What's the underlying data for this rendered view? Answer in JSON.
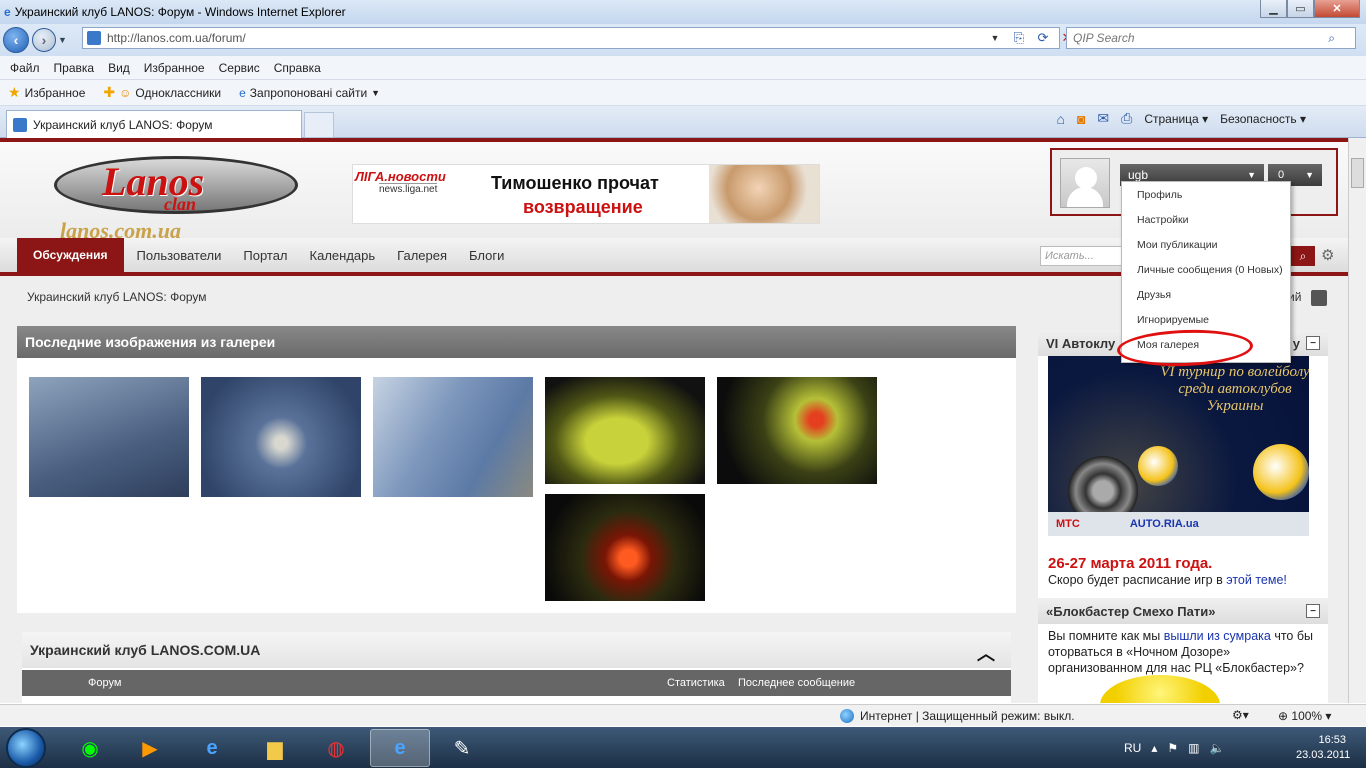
{
  "window": {
    "title": "Украинский клуб LANOS: Форум - Windows Internet Explorer"
  },
  "address": {
    "url": "http://lanos.com.ua/forum/",
    "search_placeholder": "QIP Search"
  },
  "menu": [
    "Файл",
    "Правка",
    "Вид",
    "Избранное",
    "Сервис",
    "Справка"
  ],
  "favorites": {
    "label": "Избранное",
    "items": [
      "Одноклассники",
      "Запропоновані сайти"
    ]
  },
  "tab": {
    "title": "Украинский клуб LANOS: Форум"
  },
  "command_bar": {
    "page": "Страница",
    "security": "Безопасность"
  },
  "logo": {
    "line1": "Lanos",
    "line2": "clan",
    "line3": "lanos.com.ua"
  },
  "banner": {
    "brand": "ЛIГА.новости",
    "site": "news.liga.net",
    "headline1": "Тимошенко прочат",
    "headline2": "возвращение"
  },
  "user": {
    "name": "ugb",
    "count": "0"
  },
  "nav": {
    "items": [
      "Обсуждения",
      "Пользователи",
      "Портал",
      "Календарь",
      "Галерея",
      "Блоги"
    ],
    "search_placeholder": "Искать..."
  },
  "breadcrumb": "Украинский клуб LANOS: Форум",
  "gallery": {
    "title": "Последние изображения из галереи"
  },
  "forum": {
    "title": "Украинский клуб LANOS.COM.UA",
    "col_forum": "Форум",
    "col_stats": "Статистика",
    "col_last": "Последнее сообщение"
  },
  "dropdown": [
    "Профиль",
    "Настройки",
    "Мои публикации",
    "Личные сообщения (0 Новых)",
    "Друзья",
    "Игнорируемые",
    "Моя галерея"
  ],
  "sidebar": {
    "block1_title": "VI Автоклу",
    "block1_suffix": "у",
    "poster_text": "VI турнир по волейболу среди автоклубов Украины",
    "logos": [
      "МТС",
      "AUTO.RIA.ua"
    ],
    "date": "26-27 марта 2011 года.",
    "text1": "Скоро будет расписание игр в ",
    "link1": "этой теме!",
    "block2_title": "«Блокбастер Смехо Пати»",
    "text2a": "Вы помните как мы ",
    "link2": "вышли из сумрака",
    "text2b": " что бы оторваться в «Ночном Дозоре» организованном для нас РЦ «Блокбастер»?"
  },
  "right_partial": "ий",
  "status": {
    "zone": "Интернет | Защищенный режим: выкл.",
    "zoom": "100%"
  },
  "taskbar": {
    "lang": "RU",
    "time": "16:53",
    "date": "23.03.2011"
  }
}
